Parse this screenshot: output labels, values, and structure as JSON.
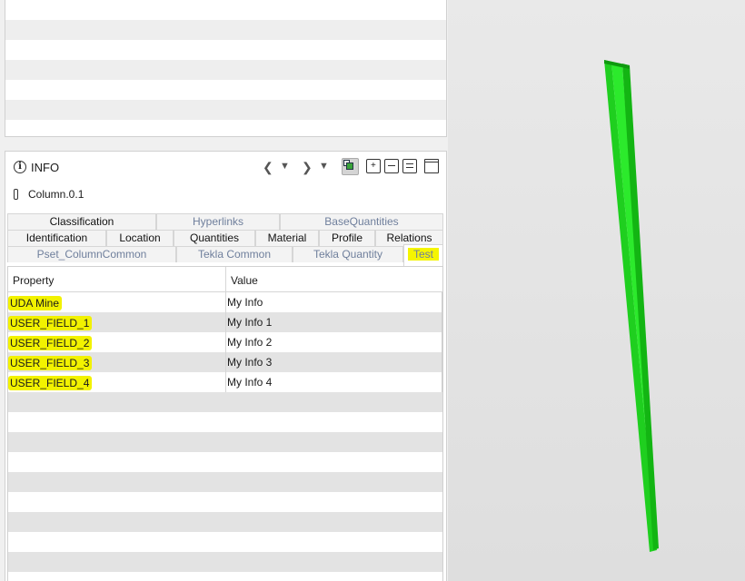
{
  "info_panel": {
    "title": "INFO",
    "entity": "Column.0.1"
  },
  "tabs": {
    "row1": [
      "Classification",
      "Hyperlinks",
      "BaseQuantities"
    ],
    "row2": [
      "Identification",
      "Location",
      "Quantities",
      "Material",
      "Profile",
      "Relations"
    ],
    "row3": [
      "Pset_ColumnCommon",
      "Tekla Common",
      "Tekla Quantity",
      "Test"
    ],
    "selected": "Test"
  },
  "table": {
    "columns": [
      "Property",
      "Value"
    ],
    "rows": [
      {
        "property": "UDA Mine",
        "value": "My Info"
      },
      {
        "property": "USER_FIELD_1",
        "value": "My Info 1"
      },
      {
        "property": "USER_FIELD_2",
        "value": "My Info 2"
      },
      {
        "property": "USER_FIELD_3",
        "value": "My Info 3"
      },
      {
        "property": "USER_FIELD_4",
        "value": "My Info 4"
      }
    ]
  },
  "icons": {
    "info": "info-circle-icon",
    "prev": "chevron-left-icon",
    "prev_menu": "caret-down-icon",
    "next": "chevron-right-icon",
    "next_menu": "caret-down-icon",
    "select_3d": "isolate-3d-icon",
    "add_set": "add-to-set-icon",
    "remove_set": "remove-from-set-icon",
    "clear_set": "clear-set-icon",
    "window": "window-icon",
    "entity": "column-entity-icon"
  },
  "colors": {
    "highlight": "#f2f200",
    "column_green": "#22dd22",
    "tab_dim_text": "#6f7f9c",
    "row_alt": "#e3e3e3"
  }
}
